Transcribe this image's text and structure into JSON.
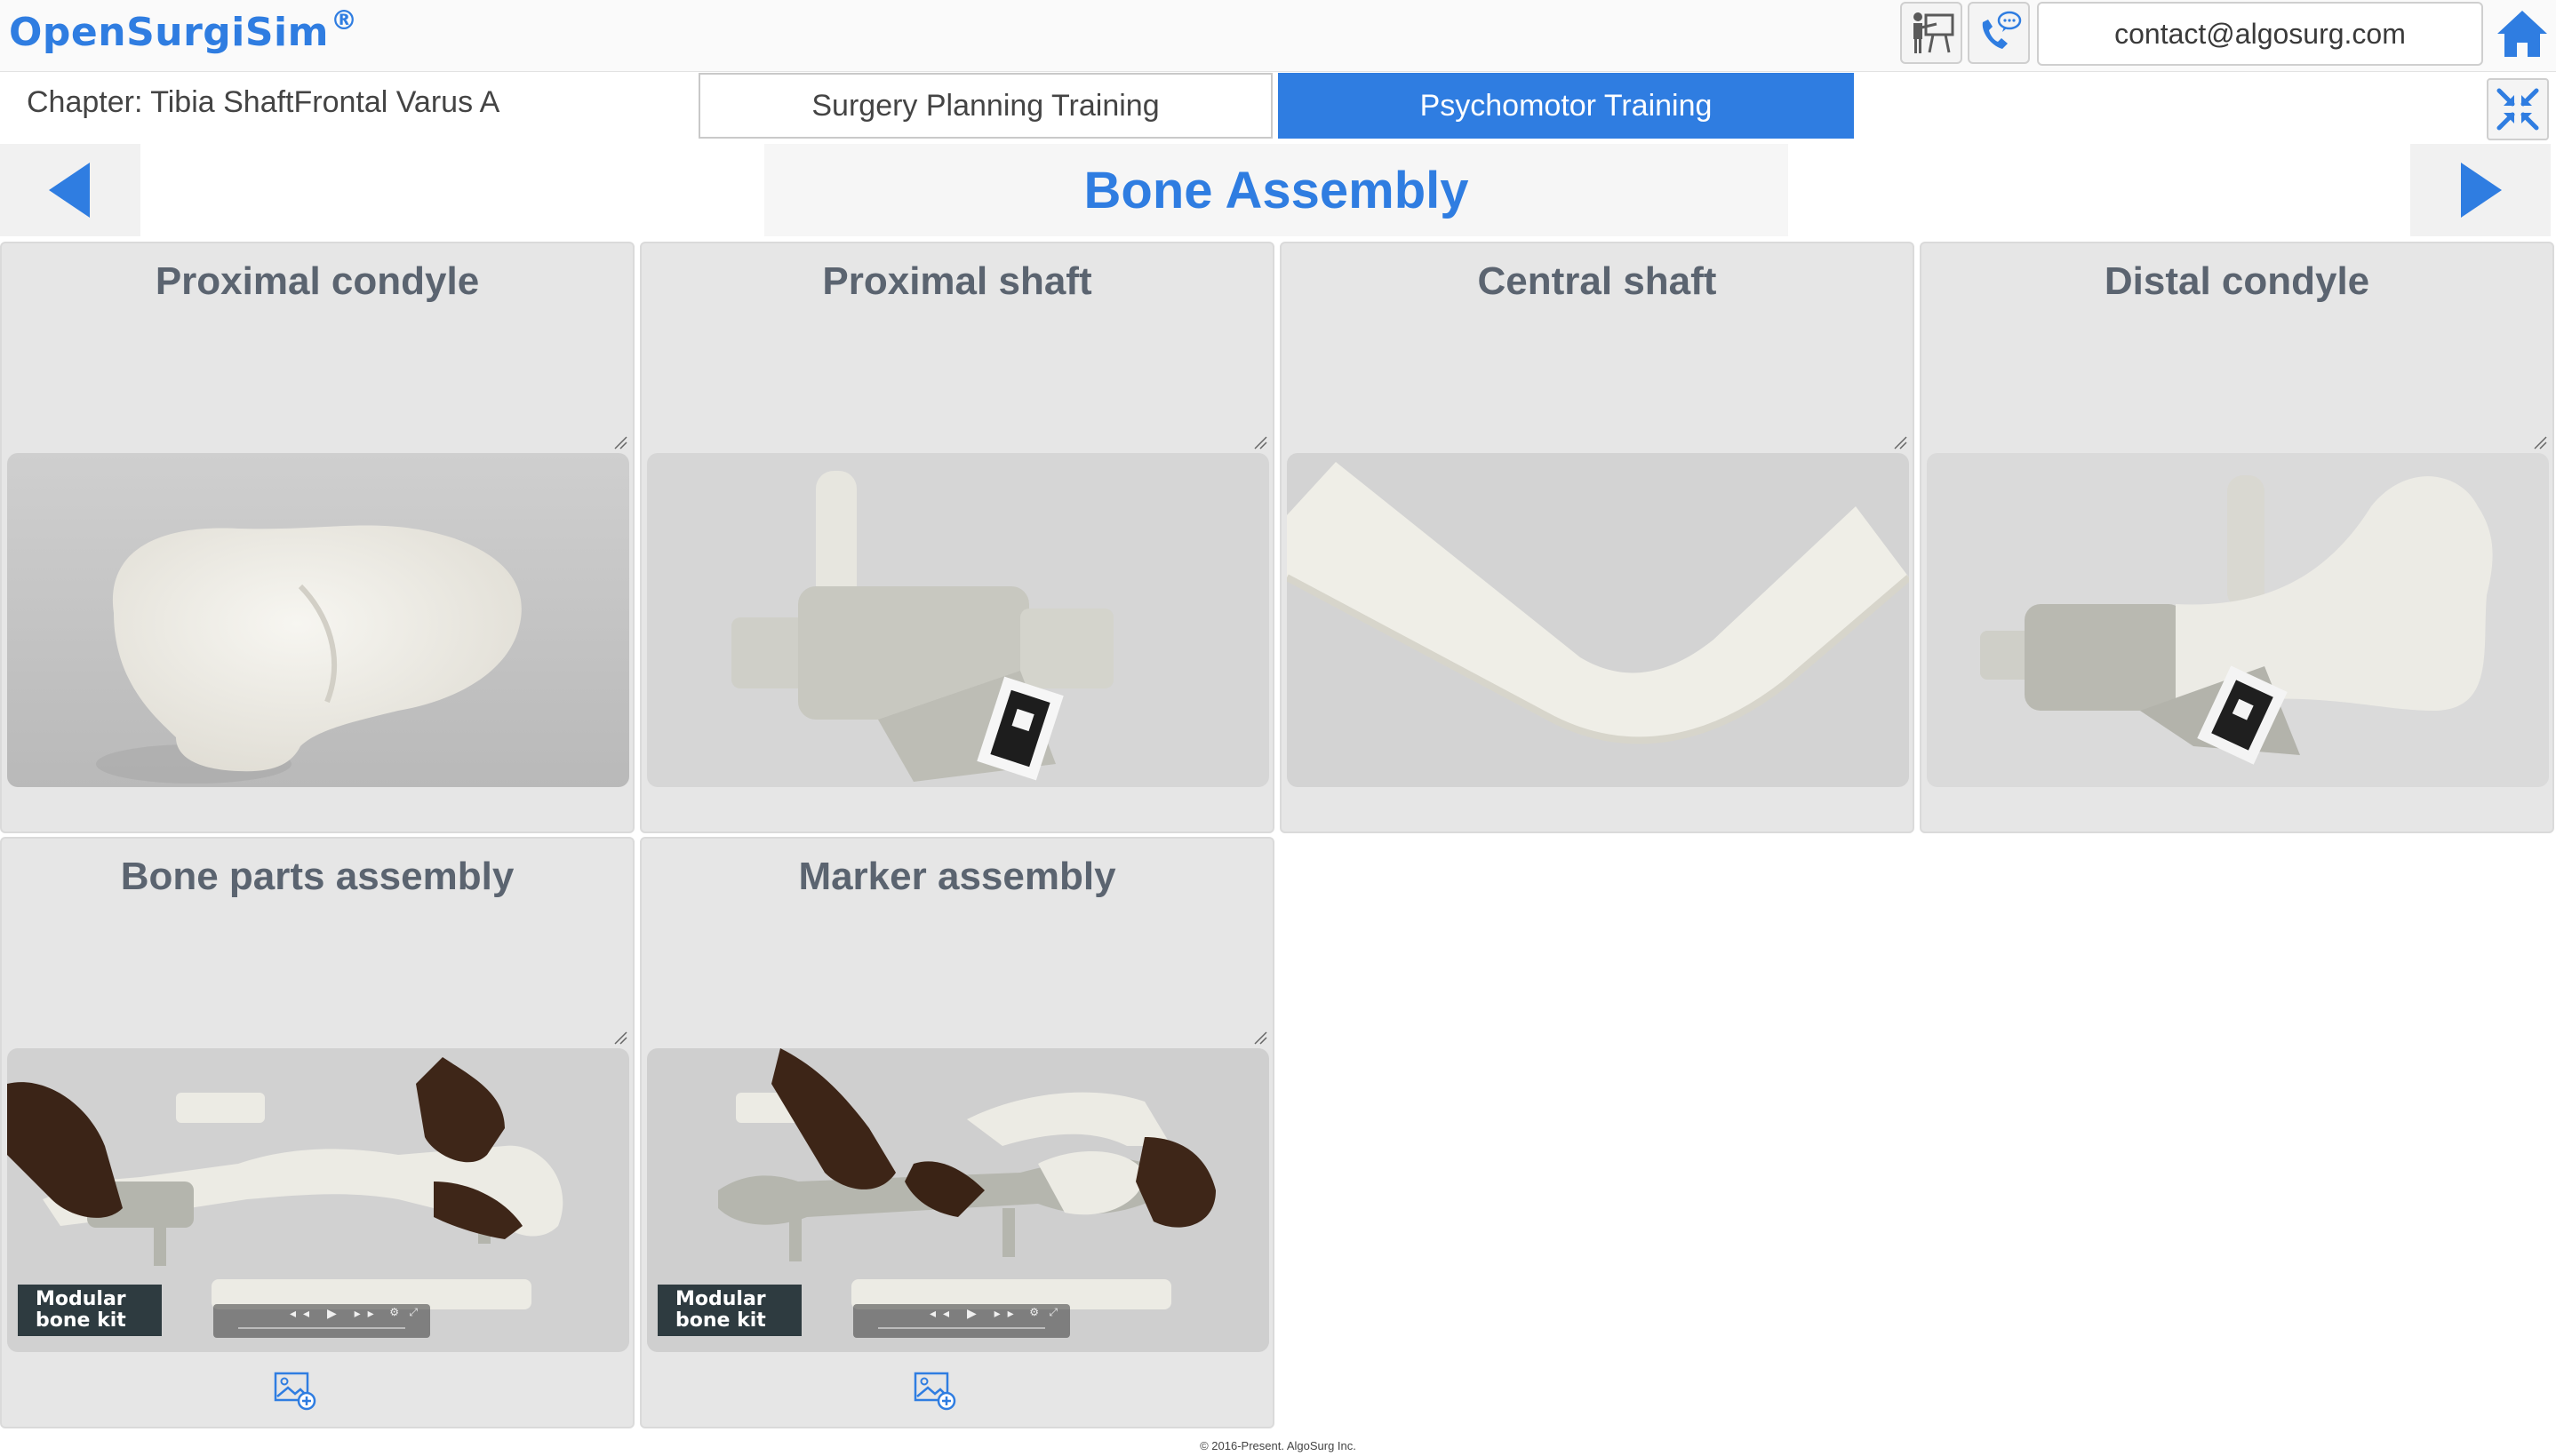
{
  "header": {
    "brand": "OpenSurgiSim",
    "brand_mark": "®",
    "contact_email": "contact@algosurg.com",
    "icons": [
      "presentation-icon",
      "phone-chat-icon",
      "home-icon"
    ]
  },
  "chapter": {
    "label": "Chapter: Tibia ShaftFrontal Varus A"
  },
  "tabs": [
    {
      "label": "Surgery Planning Training",
      "active": false
    },
    {
      "label": "Psychomotor Training",
      "active": true
    }
  ],
  "section": {
    "title": "Bone Assembly"
  },
  "cards": [
    {
      "title": "Proximal condyle",
      "media": "image"
    },
    {
      "title": "Proximal shaft",
      "media": "image"
    },
    {
      "title": "Central shaft",
      "media": "image"
    },
    {
      "title": "Distal condyle",
      "media": "image"
    },
    {
      "title": "Bone parts assembly",
      "media": "video",
      "video_label_line1": "Modular",
      "video_label_line2": "bone kit"
    },
    {
      "title": "Marker assembly",
      "media": "video",
      "video_label_line1": "Modular",
      "video_label_line2": "bone kit"
    }
  ],
  "footer": {
    "copyright": "© 2016-Present. AlgoSurg Inc."
  },
  "colors": {
    "accent": "#2f7de1",
    "card_bg": "#e6e6e6",
    "card_title": "#5b6470"
  }
}
